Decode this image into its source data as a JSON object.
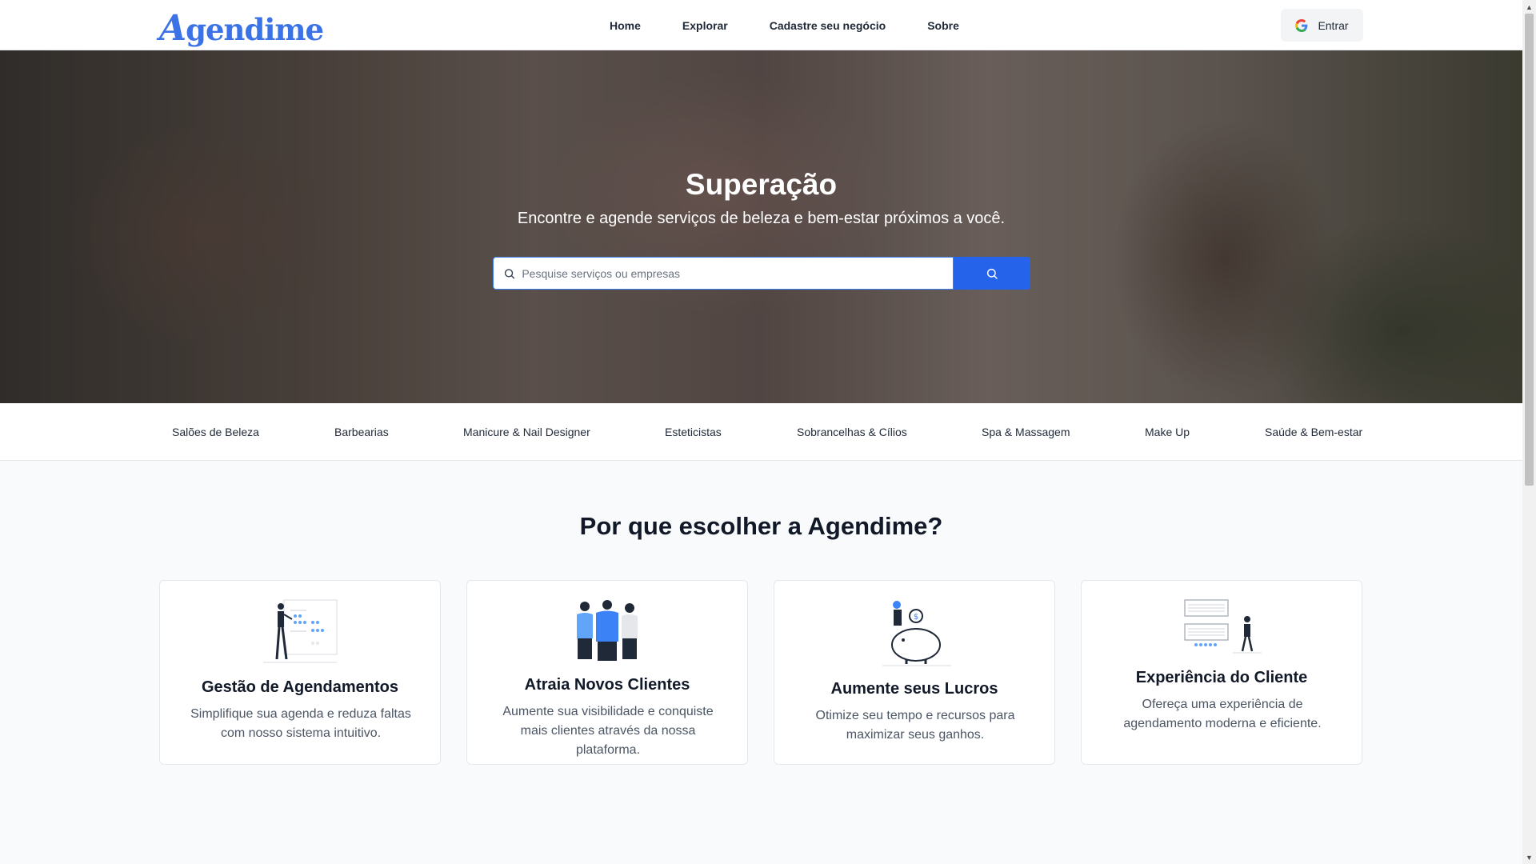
{
  "header": {
    "logo_initial": "A",
    "logo_rest": "gendime",
    "nav": [
      "Home",
      "Explorar",
      "Cadastre seu negócio",
      "Sobre"
    ],
    "login_label": "Entrar"
  },
  "hero": {
    "title": "Superação",
    "subtitle": "Encontre e agende serviços de beleza e bem-estar próximos a você.",
    "search_placeholder": "Pesquise serviços ou empresas",
    "search_value": ""
  },
  "categories": [
    "Salões de Beleza",
    "Barbearias",
    "Manicure & Nail Designer",
    "Esteticistas",
    "Sobrancelhas & Cílios",
    "Spa & Massagem",
    "Make Up",
    "Saúde & Bem-estar"
  ],
  "why": {
    "title": "Por que escolher a Agendime?",
    "cards": [
      {
        "title": "Gestão de Agendamentos",
        "text": "Simplifique sua agenda e reduza faltas com nosso sistema intuitivo."
      },
      {
        "title": "Atraia Novos Clientes",
        "text": "Aumente sua visibilidade e conquiste mais clientes através da nossa plataforma."
      },
      {
        "title": "Aumente seus Lucros",
        "text": "Otimize seu tempo e recursos para maximizar seus ganhos."
      },
      {
        "title": "Experiência do Cliente",
        "text": "Ofereça uma experiência de agendamento moderna e eficiente."
      }
    ]
  },
  "colors": {
    "brand": "#3b72e6",
    "primary_button": "#2563eb"
  }
}
